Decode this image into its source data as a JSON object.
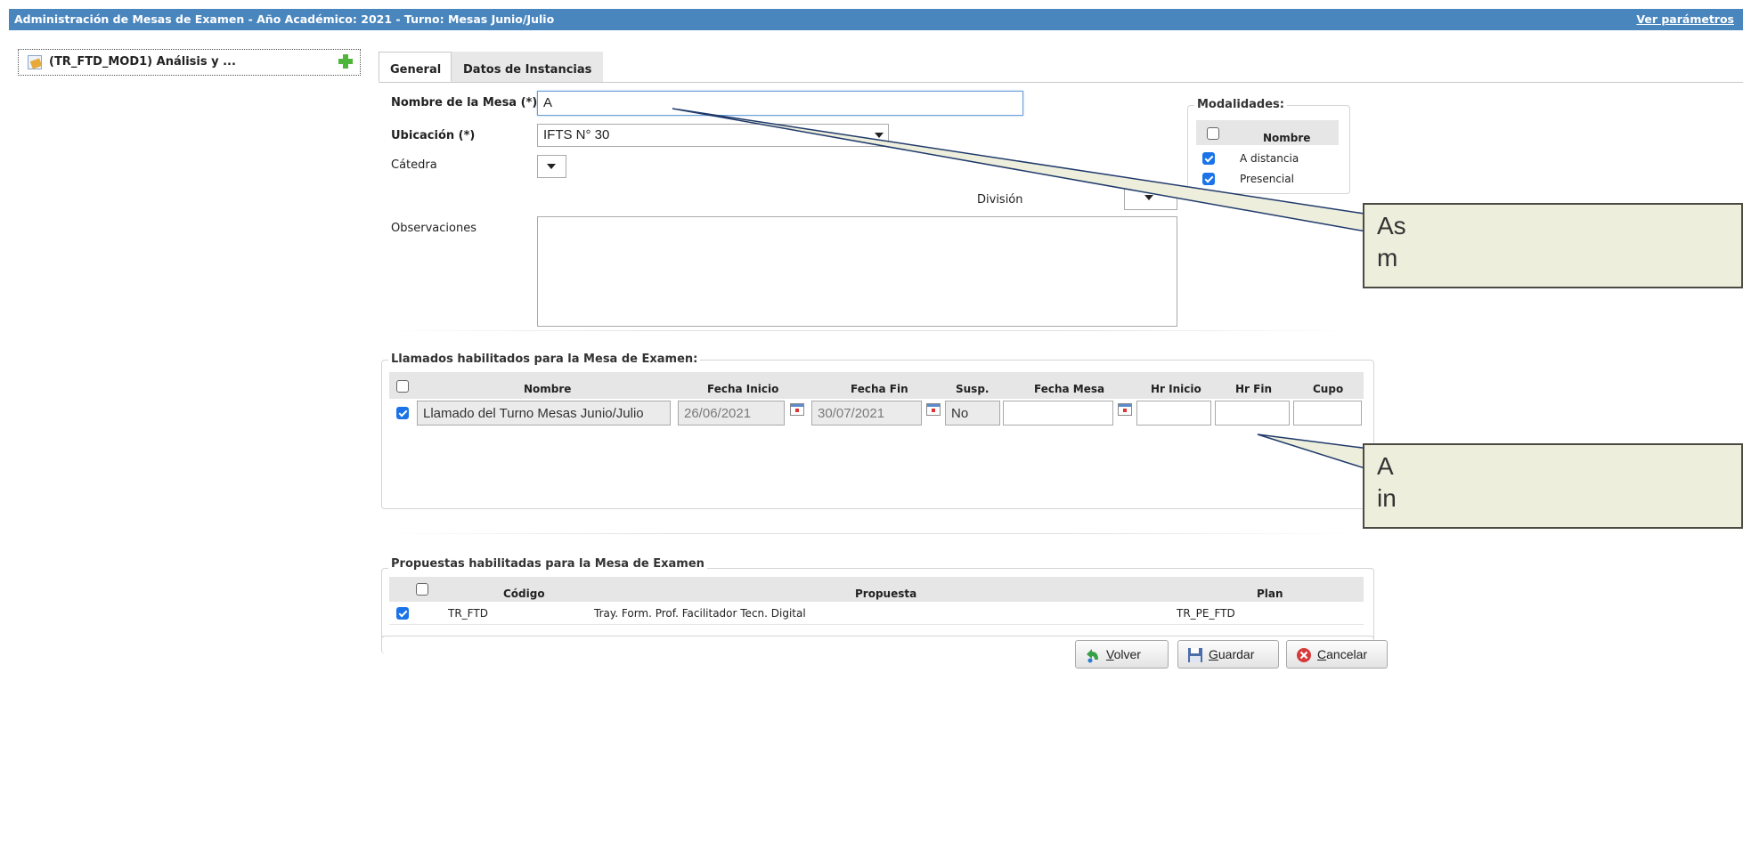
{
  "header": {
    "title": "Administración de Mesas de Examen - Año Académico: 2021 - Turno: Mesas Junio/Julio",
    "params_link": "Ver parámetros"
  },
  "tree": {
    "item_label": "(TR_FTD_MOD1) Análisis y ..."
  },
  "tabs": [
    "General",
    "Datos de Instancias"
  ],
  "form": {
    "nombre_label": "Nombre de la Mesa (*)",
    "nombre_value": "A",
    "ubicacion_label": "Ubicación (*)",
    "ubicacion_value": "IFTS N° 30",
    "catedra_label": "Cátedra",
    "catedra_value": "",
    "division_label": "División",
    "observaciones_label": "Observaciones",
    "observaciones_value": ""
  },
  "modalidades": {
    "legend": "Modalidades:",
    "header": "Nombre",
    "items": [
      {
        "label": "A distancia",
        "checked": true
      },
      {
        "label": "Presencial",
        "checked": true
      }
    ]
  },
  "llamados": {
    "legend": "Llamados habilitados para la Mesa de Examen:",
    "columns": [
      "Nombre",
      "Fecha Inicio",
      "Fecha Fin",
      "Susp.",
      "Fecha Mesa",
      "Hr Inicio",
      "Hr Fin",
      "Cupo"
    ],
    "rows": [
      {
        "checked": true,
        "nombre": "Llamado del Turno Mesas Junio/Julio",
        "fecha_inicio": "26/06/2021",
        "fecha_fin": "30/07/2021",
        "susp": "No",
        "fecha_mesa": "",
        "hr_inicio": "",
        "hr_fin": "",
        "cupo": ""
      }
    ]
  },
  "propuestas": {
    "legend": "Propuestas habilitadas para la Mesa de Examen",
    "columns": [
      "Código",
      "Propuesta",
      "Plan"
    ],
    "rows": [
      {
        "checked": true,
        "codigo": "TR_FTD",
        "propuesta": "Tray. Form. Prof. Facilitador Tecn. Digital",
        "plan": "TR_PE_FTD"
      }
    ]
  },
  "callouts": [
    {
      "text_line1": "As",
      "text_line2": "m"
    },
    {
      "text_line1": "A",
      "text_line2": "in"
    }
  ],
  "buttons": {
    "volver": {
      "accel": "V",
      "rest": "olver"
    },
    "guardar": {
      "accel": "G",
      "rest": "uardar"
    },
    "cancelar": {
      "accel": "C",
      "rest": "ancelar"
    }
  }
}
